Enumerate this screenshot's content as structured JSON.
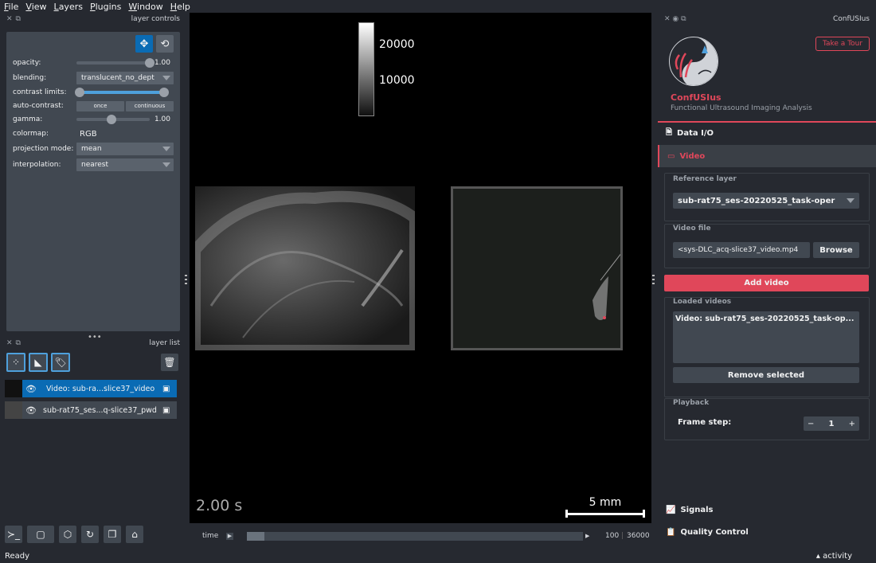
{
  "menu": [
    "File",
    "View",
    "Layers",
    "Plugins",
    "Window",
    "Help"
  ],
  "layer_controls": {
    "title": "layer controls",
    "opacity_label": "opacity:",
    "opacity_value": "1.00",
    "blending_label": "blending:",
    "blending_value": "translucent_no_dept",
    "contrast_label": "contrast limits:",
    "auto_contrast_label": "auto-contrast:",
    "once": "once",
    "continuous": "continuous",
    "gamma_label": "gamma:",
    "gamma_value": "1.00",
    "colormap_label": "colormap:",
    "colormap_value": "RGB",
    "projection_label": "projection mode:",
    "projection_value": "mean",
    "interpolation_label": "interpolation:",
    "interpolation_value": "nearest",
    "opacity": 1.0,
    "gamma": 1.0
  },
  "layer_list": {
    "title": "layer list",
    "layers": [
      {
        "name": "Video: sub-ra...slice37_video",
        "selected": true
      },
      {
        "name": "sub-rat75_ses...q-slice37_pwd",
        "selected": false
      }
    ]
  },
  "canvas": {
    "colorbar_ticks": [
      "20000",
      "10000"
    ],
    "time_label": "2.00 s",
    "scale_label": "5 mm"
  },
  "time": {
    "label": "time",
    "current": "100",
    "total": "36000",
    "progress": 0.003
  },
  "plugin": {
    "dock_title": "ConfUSIus",
    "tour_button": "Take a Tour",
    "app_name": "ConfUSIus",
    "subtitle": "Functional Ultrasound Imaging Analysis",
    "nav_data_io": "Data I/O",
    "nav_video": "Video",
    "reference_layer_title": "Reference layer",
    "reference_layer_value": "sub-rat75_ses-20220525_task-oper",
    "video_file_title": "Video file",
    "video_file_value": "<sys-DLC_acq-slice37_video.mp4",
    "browse": "Browse",
    "add_video": "Add video",
    "loaded_videos_title": "Loaded videos",
    "loaded_video_item": "Video: sub-rat75_ses-20220525_task-op...",
    "remove_selected": "Remove selected",
    "playback_title": "Playback",
    "frame_step_label": "Frame step:",
    "frame_step_value": "1",
    "nav_signals": "Signals",
    "nav_quality": "Quality Control"
  },
  "status": {
    "left": "Ready",
    "right": "activity"
  },
  "colors": {
    "accent": "#e0475a",
    "selected": "#0a6bb4",
    "panel": "#414851"
  }
}
